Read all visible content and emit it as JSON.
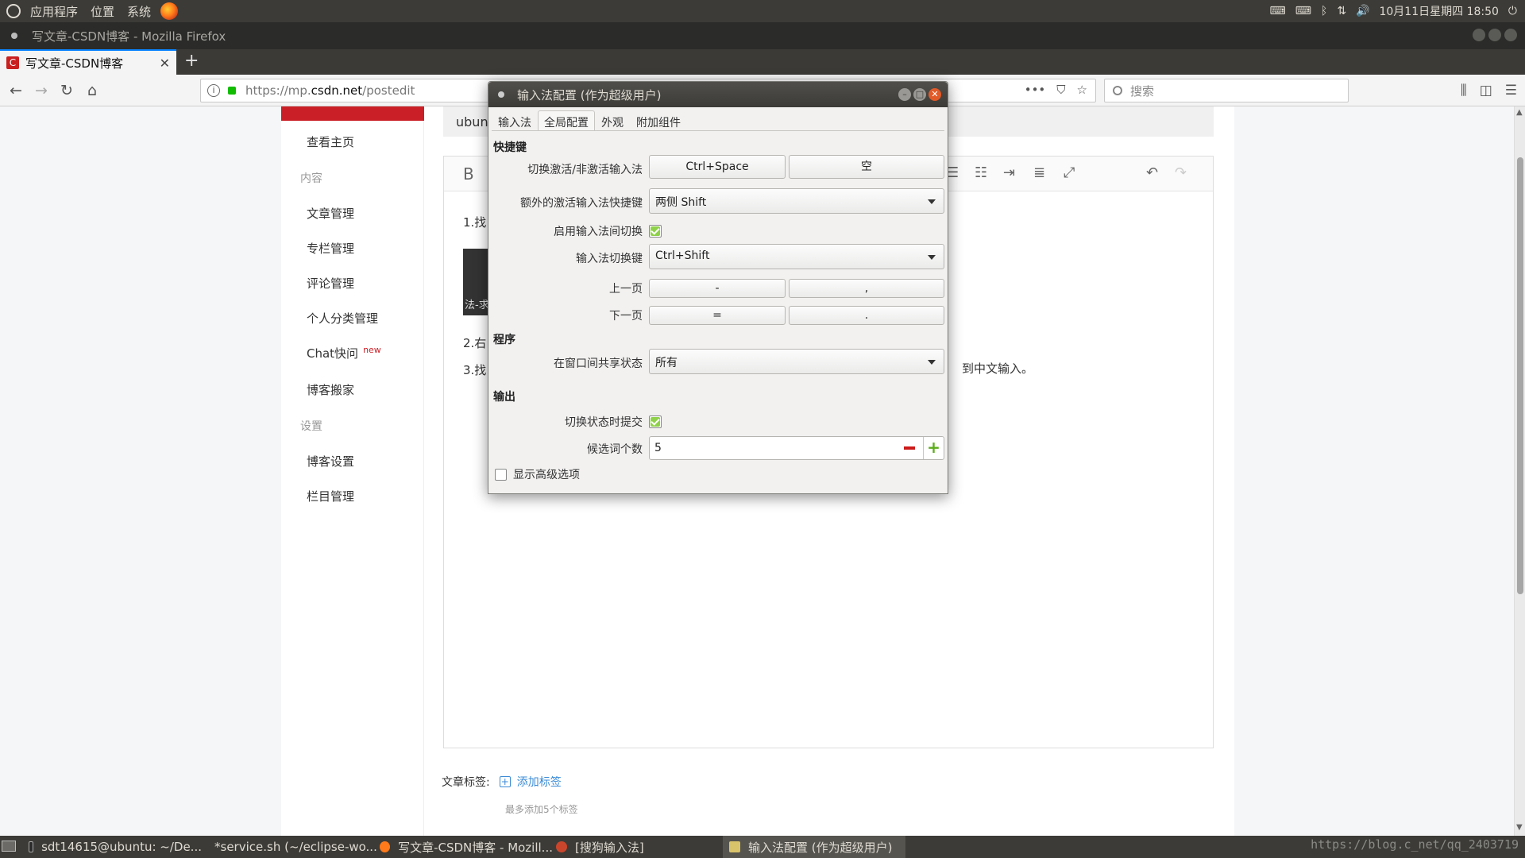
{
  "system_panel": {
    "menus": [
      "应用程序",
      "位置",
      "系统"
    ],
    "clock": "10月11日星期四 18:50"
  },
  "window": {
    "title": "写文章-CSDN博客 - Mozilla Firefox"
  },
  "browser": {
    "tab_label": "写文章-CSDN博客",
    "tab_favicon": "C",
    "url_prefix": "https://mp.",
    "url_domain": "csdn.net",
    "url_path": "/postedit",
    "search_placeholder": "搜索"
  },
  "sidebar": {
    "view_home": "查看主页",
    "content_header": "内容",
    "items": [
      "文章管理",
      "专栏管理",
      "评论管理",
      "个人分类管理",
      "Chat快问",
      "博客搬家"
    ],
    "chat_badge": "new",
    "settings_header": "设置",
    "settings_items": [
      "博客设置",
      "栏目管理"
    ]
  },
  "editor": {
    "title_partial": "ubunt",
    "bold_label": "B",
    "line1": "1.找",
    "img_caption": "法-求",
    "line2": "2.右",
    "line3": "3.找",
    "line3_right": "到中文输入。",
    "tags_label": "文章标签:",
    "add_tag": "添加标签",
    "tags_hint": "最多添加5个标签"
  },
  "dialog": {
    "title": "输入法配置 (作为超级用户)",
    "tabs": [
      "输入法",
      "全局配置",
      "外观",
      "附加组件"
    ],
    "active_tab": "全局配置",
    "section_shortcuts": "快捷键",
    "toggle_label": "切换激活/非激活输入法",
    "toggle_key1": "Ctrl+Space",
    "toggle_key2": "空",
    "extra_label": "额外的激活输入法快捷键",
    "extra_value": "两侧 Shift",
    "enable_switch_label": "启用输入法间切换",
    "enable_switch_checked": true,
    "switch_key_label": "输入法切换键",
    "switch_key_value": "Ctrl+Shift",
    "prev_page_label": "上一页",
    "prev_key1": "-",
    "prev_key2": ",",
    "next_page_label": "下一页",
    "next_key1": "=",
    "next_key2": ".",
    "section_program": "程序",
    "share_state_label": "在窗口间共享状态",
    "share_state_value": "所有",
    "section_output": "输出",
    "commit_label": "切换状态时提交",
    "commit_checked": true,
    "candidates_label": "候选词个数",
    "candidates_value": "5",
    "advanced_label": "显示高级选项",
    "advanced_checked": false
  },
  "taskbar": {
    "items": [
      "sdt14615@ubuntu: ~/De...",
      "*service.sh (~/eclipse-wo...",
      "写文章-CSDN博客 - Mozill...",
      "[搜狗输入法]",
      "输入法配置 (作为超级用户)"
    ],
    "watermark": "https://blog.c_net/qq_2403719"
  },
  "colors": {
    "csdn_red": "#ca1f26",
    "ubuntu_panel": "#3c3b37",
    "link_blue": "#3b8bd6",
    "check_green": "#8fd14a",
    "close_orange": "#e25a28"
  }
}
